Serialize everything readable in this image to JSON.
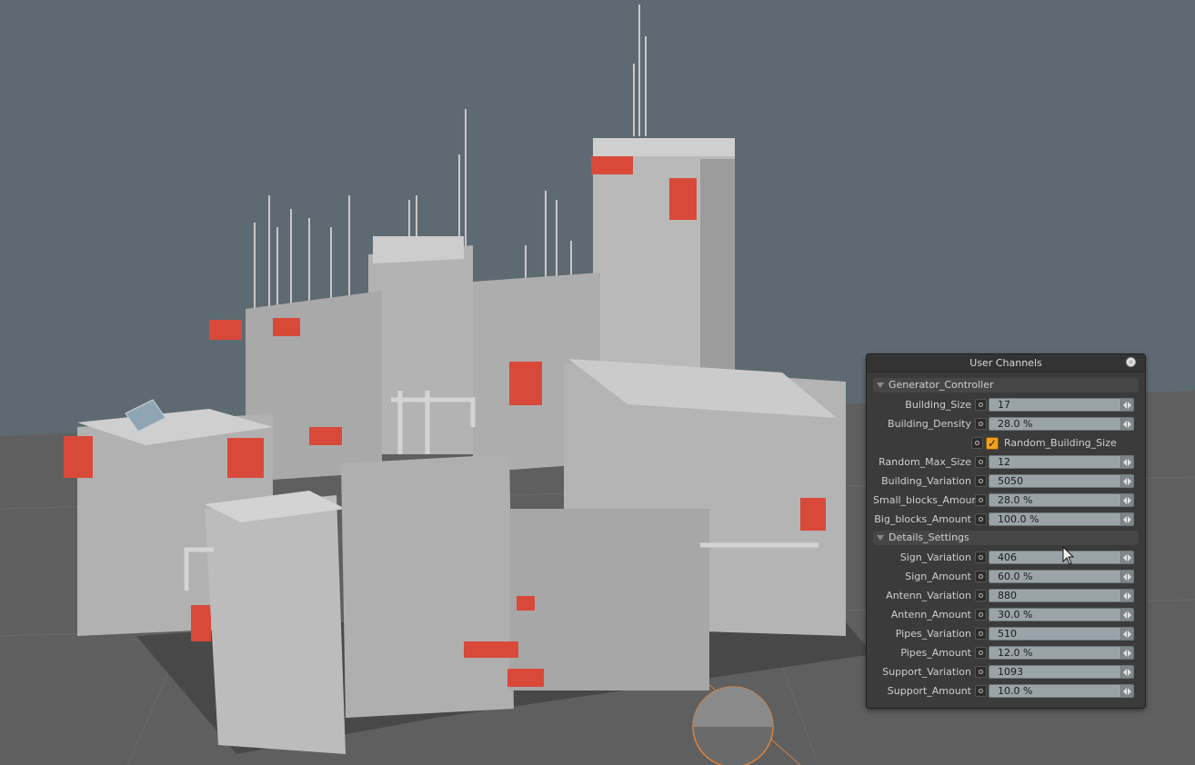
{
  "panel": {
    "title": "User Channels",
    "groups": [
      {
        "name": "Generator_Controller",
        "fields": [
          {
            "label": "Building_Size",
            "value": "17"
          },
          {
            "label": "Building_Density",
            "value": "28.0 %"
          }
        ],
        "checkbox": {
          "label": "Random_Building_Size",
          "checked": true,
          "mark": "✓"
        },
        "fields2": [
          {
            "label": "Random_Max_Size",
            "value": "12"
          },
          {
            "label": "Building_Variation",
            "value": "5050"
          },
          {
            "label": "Small_blocks_Amount",
            "value": "28.0 %"
          },
          {
            "label": "Big_blocks_Amount",
            "value": "100.0 %"
          }
        ]
      },
      {
        "name": "Details_Settings",
        "fields": [
          {
            "label": "Sign_Variation",
            "value": "406"
          },
          {
            "label": "Sign_Amount",
            "value": "60.0 %"
          },
          {
            "label": "Antenn_Variation",
            "value": "880"
          },
          {
            "label": "Antenn_Amount",
            "value": "30.0 %"
          },
          {
            "label": "Pipes_Variation",
            "value": "510"
          },
          {
            "label": "Pipes_Amount",
            "value": "12.0 %"
          },
          {
            "label": "Support_Variation",
            "value": "1093"
          },
          {
            "label": "Support_Amount",
            "value": "10.0 %"
          }
        ]
      }
    ]
  },
  "colors": {
    "background": "#5e6a72",
    "ground": "#5f5f60",
    "building": "#b8b8b8",
    "accent_red": "#d9493a",
    "checkbox": "#f0a020"
  },
  "icons": {
    "close": "close-icon",
    "collapse": "triangle-down-icon",
    "animate": "keyframe-icon",
    "spin": "spinner-arrows-icon",
    "cursor": "mouse-cursor-icon",
    "navigation": "navigation-gizmo-icon"
  }
}
